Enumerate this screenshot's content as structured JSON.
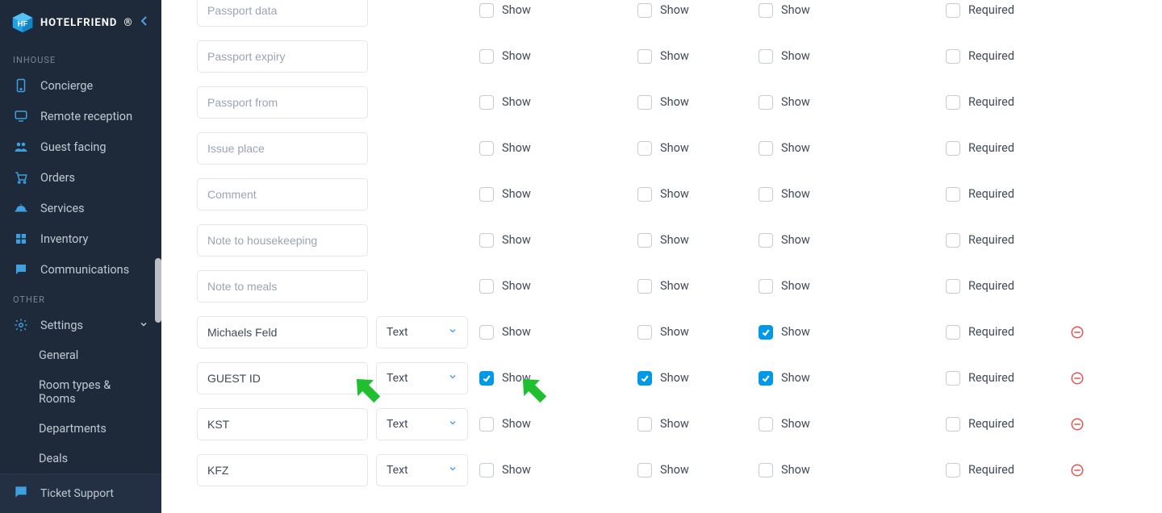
{
  "brand": {
    "name": "HOTELFRIEND"
  },
  "sidebar": {
    "sections": [
      {
        "label": "INHOUSE",
        "items": [
          {
            "icon": "concierge",
            "label": "Concierge"
          },
          {
            "icon": "remote-reception",
            "label": "Remote reception"
          },
          {
            "icon": "guest-facing",
            "label": "Guest facing"
          },
          {
            "icon": "orders",
            "label": "Orders"
          },
          {
            "icon": "services",
            "label": "Services"
          },
          {
            "icon": "inventory",
            "label": "Inventory"
          },
          {
            "icon": "communications",
            "label": "Communications"
          }
        ]
      },
      {
        "label": "OTHER",
        "items": [
          {
            "icon": "settings",
            "label": "Settings",
            "expanded": true,
            "children": [
              "General",
              "Room types & Rooms",
              "Departments",
              "Deals"
            ]
          }
        ]
      }
    ],
    "footer": {
      "label": "Ticket Support"
    }
  },
  "labels": {
    "show": "Show",
    "required": "Required"
  },
  "type_text": "Text",
  "rows": [
    {
      "placeholder": "Passport data",
      "value": "",
      "custom": false,
      "c1": false,
      "c2": false,
      "c3": false,
      "req": false
    },
    {
      "placeholder": "Passport expiry",
      "value": "",
      "custom": false,
      "c1": false,
      "c2": false,
      "c3": false,
      "req": false
    },
    {
      "placeholder": "Passport from",
      "value": "",
      "custom": false,
      "c1": false,
      "c2": false,
      "c3": false,
      "req": false
    },
    {
      "placeholder": "Issue place",
      "value": "",
      "custom": false,
      "c1": false,
      "c2": false,
      "c3": false,
      "req": false
    },
    {
      "placeholder": "Comment",
      "value": "",
      "custom": false,
      "c1": false,
      "c2": false,
      "c3": false,
      "req": false
    },
    {
      "placeholder": "Note to housekeeping",
      "value": "",
      "custom": false,
      "c1": false,
      "c2": false,
      "c3": false,
      "req": false
    },
    {
      "placeholder": "Note to meals",
      "value": "",
      "custom": false,
      "c1": false,
      "c2": false,
      "c3": false,
      "req": false
    },
    {
      "placeholder": "",
      "value": "Michaels Feld",
      "custom": true,
      "c1": false,
      "c2": false,
      "c3": true,
      "req": false
    },
    {
      "placeholder": "",
      "value": "GUEST ID",
      "custom": true,
      "c1": true,
      "c2": true,
      "c3": true,
      "req": false
    },
    {
      "placeholder": "",
      "value": "KST",
      "custom": true,
      "c1": false,
      "c2": false,
      "c3": false,
      "req": false
    },
    {
      "placeholder": "",
      "value": "KFZ",
      "custom": true,
      "c1": false,
      "c2": false,
      "c3": false,
      "req": false
    }
  ]
}
